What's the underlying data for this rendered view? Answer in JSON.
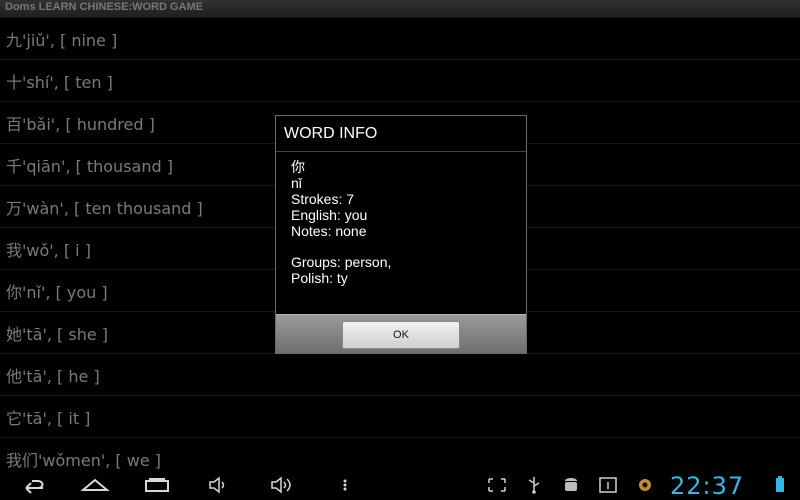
{
  "app": {
    "title": "Doms LEARN CHINESE:WORD GAME"
  },
  "list": {
    "items": [
      "九'jiǔ', [ nine ]",
      "十'shí', [ ten ]",
      "百'bǎi', [ hundred ]",
      "千'qiān', [ thousand ]",
      "万'wàn', [ ten thousand ]",
      "我'wǒ', [ i ]",
      "你'nǐ', [ you ]",
      "她'tā', [ she ]",
      "他'tā', [ he ]",
      "它'tā', [ it ]",
      "我们'wǒmen', [ we ]"
    ]
  },
  "dialog": {
    "title": "WORD INFO",
    "character": "你",
    "pinyin": "nǐ",
    "strokes": "Strokes: 7",
    "english": "English: you",
    "notes": "Notes: none",
    "groups": "Groups: person,",
    "polish": "Polish: ty",
    "ok_label": "OK"
  },
  "status_bar": {
    "clock": "22:37",
    "clock_color": "#35b6e8",
    "icons": [
      "back-icon",
      "home-icon",
      "recent-apps-icon",
      "volume-down-icon",
      "volume-up-icon",
      "menu-icon",
      "screenshot-icon",
      "usb-icon",
      "android-debug-icon",
      "notification-1-icon",
      "settings-icon",
      "battery-icon"
    ]
  }
}
